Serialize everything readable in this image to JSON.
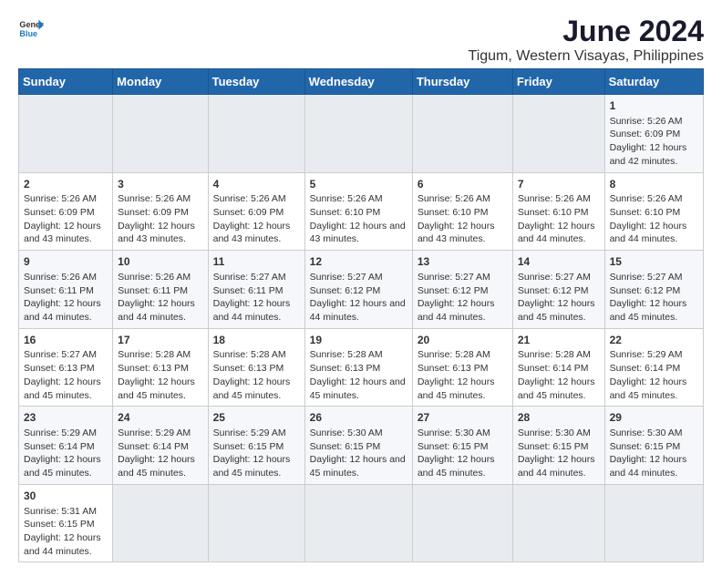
{
  "header": {
    "logo_general": "General",
    "logo_blue": "Blue",
    "main_title": "June 2024",
    "subtitle": "Tigum, Western Visayas, Philippines"
  },
  "days_of_week": [
    "Sunday",
    "Monday",
    "Tuesday",
    "Wednesday",
    "Thursday",
    "Friday",
    "Saturday"
  ],
  "weeks": [
    [
      {
        "day": "",
        "empty": true
      },
      {
        "day": "",
        "empty": true
      },
      {
        "day": "",
        "empty": true
      },
      {
        "day": "",
        "empty": true
      },
      {
        "day": "",
        "empty": true
      },
      {
        "day": "",
        "empty": true
      },
      {
        "day": "1",
        "sunrise": "5:26 AM",
        "sunset": "6:09 PM",
        "daylight": "12 hours and 42 minutes."
      }
    ],
    [
      {
        "day": "2",
        "sunrise": "5:26 AM",
        "sunset": "6:09 PM",
        "daylight": "12 hours and 43 minutes."
      },
      {
        "day": "3",
        "sunrise": "5:26 AM",
        "sunset": "6:09 PM",
        "daylight": "12 hours and 43 minutes."
      },
      {
        "day": "4",
        "sunrise": "5:26 AM",
        "sunset": "6:09 PM",
        "daylight": "12 hours and 43 minutes."
      },
      {
        "day": "5",
        "sunrise": "5:26 AM",
        "sunset": "6:10 PM",
        "daylight": "12 hours and 43 minutes."
      },
      {
        "day": "6",
        "sunrise": "5:26 AM",
        "sunset": "6:10 PM",
        "daylight": "12 hours and 43 minutes."
      },
      {
        "day": "7",
        "sunrise": "5:26 AM",
        "sunset": "6:10 PM",
        "daylight": "12 hours and 44 minutes."
      },
      {
        "day": "8",
        "sunrise": "5:26 AM",
        "sunset": "6:10 PM",
        "daylight": "12 hours and 44 minutes."
      }
    ],
    [
      {
        "day": "9",
        "sunrise": "5:26 AM",
        "sunset": "6:11 PM",
        "daylight": "12 hours and 44 minutes."
      },
      {
        "day": "10",
        "sunrise": "5:26 AM",
        "sunset": "6:11 PM",
        "daylight": "12 hours and 44 minutes."
      },
      {
        "day": "11",
        "sunrise": "5:27 AM",
        "sunset": "6:11 PM",
        "daylight": "12 hours and 44 minutes."
      },
      {
        "day": "12",
        "sunrise": "5:27 AM",
        "sunset": "6:12 PM",
        "daylight": "12 hours and 44 minutes."
      },
      {
        "day": "13",
        "sunrise": "5:27 AM",
        "sunset": "6:12 PM",
        "daylight": "12 hours and 44 minutes."
      },
      {
        "day": "14",
        "sunrise": "5:27 AM",
        "sunset": "6:12 PM",
        "daylight": "12 hours and 45 minutes."
      },
      {
        "day": "15",
        "sunrise": "5:27 AM",
        "sunset": "6:12 PM",
        "daylight": "12 hours and 45 minutes."
      }
    ],
    [
      {
        "day": "16",
        "sunrise": "5:27 AM",
        "sunset": "6:13 PM",
        "daylight": "12 hours and 45 minutes."
      },
      {
        "day": "17",
        "sunrise": "5:28 AM",
        "sunset": "6:13 PM",
        "daylight": "12 hours and 45 minutes."
      },
      {
        "day": "18",
        "sunrise": "5:28 AM",
        "sunset": "6:13 PM",
        "daylight": "12 hours and 45 minutes."
      },
      {
        "day": "19",
        "sunrise": "5:28 AM",
        "sunset": "6:13 PM",
        "daylight": "12 hours and 45 minutes."
      },
      {
        "day": "20",
        "sunrise": "5:28 AM",
        "sunset": "6:13 PM",
        "daylight": "12 hours and 45 minutes."
      },
      {
        "day": "21",
        "sunrise": "5:28 AM",
        "sunset": "6:14 PM",
        "daylight": "12 hours and 45 minutes."
      },
      {
        "day": "22",
        "sunrise": "5:29 AM",
        "sunset": "6:14 PM",
        "daylight": "12 hours and 45 minutes."
      }
    ],
    [
      {
        "day": "23",
        "sunrise": "5:29 AM",
        "sunset": "6:14 PM",
        "daylight": "12 hours and 45 minutes."
      },
      {
        "day": "24",
        "sunrise": "5:29 AM",
        "sunset": "6:14 PM",
        "daylight": "12 hours and 45 minutes."
      },
      {
        "day": "25",
        "sunrise": "5:29 AM",
        "sunset": "6:15 PM",
        "daylight": "12 hours and 45 minutes."
      },
      {
        "day": "26",
        "sunrise": "5:30 AM",
        "sunset": "6:15 PM",
        "daylight": "12 hours and 45 minutes."
      },
      {
        "day": "27",
        "sunrise": "5:30 AM",
        "sunset": "6:15 PM",
        "daylight": "12 hours and 45 minutes."
      },
      {
        "day": "28",
        "sunrise": "5:30 AM",
        "sunset": "6:15 PM",
        "daylight": "12 hours and 44 minutes."
      },
      {
        "day": "29",
        "sunrise": "5:30 AM",
        "sunset": "6:15 PM",
        "daylight": "12 hours and 44 minutes."
      }
    ],
    [
      {
        "day": "30",
        "sunrise": "5:31 AM",
        "sunset": "6:15 PM",
        "daylight": "12 hours and 44 minutes."
      },
      {
        "day": "",
        "empty": true
      },
      {
        "day": "",
        "empty": true
      },
      {
        "day": "",
        "empty": true
      },
      {
        "day": "",
        "empty": true
      },
      {
        "day": "",
        "empty": true
      },
      {
        "day": "",
        "empty": true
      }
    ]
  ],
  "labels": {
    "sunrise_prefix": "Sunrise: ",
    "sunset_prefix": "Sunset: ",
    "daylight_prefix": "Daylight: "
  }
}
